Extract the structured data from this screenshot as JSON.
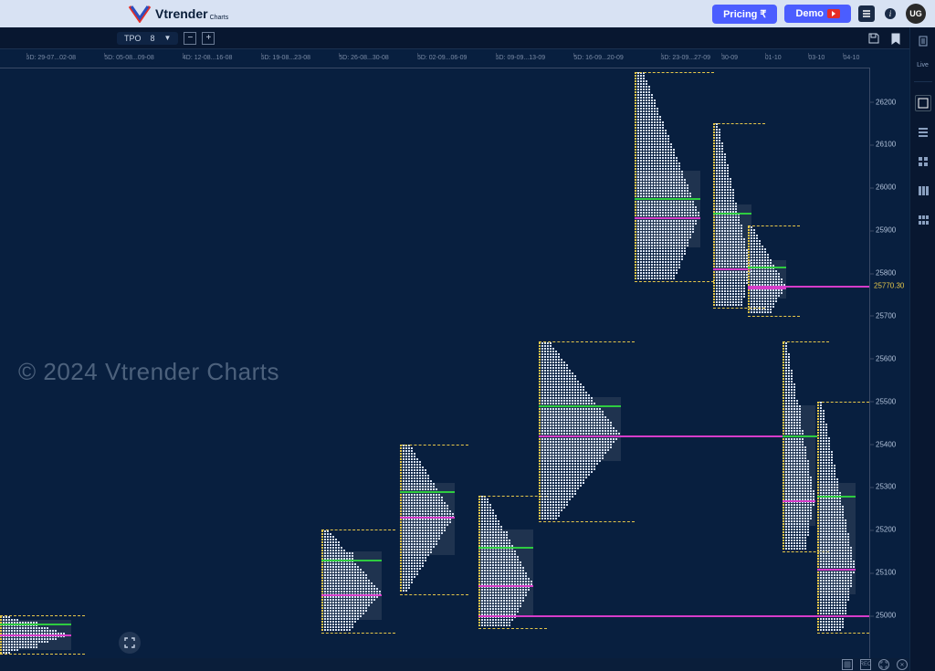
{
  "header": {
    "brand": "Vtrender",
    "brand_sub": "Charts",
    "pricing_label": "Pricing ₹",
    "demo_label": "Demo",
    "avatar_initials": "UG"
  },
  "toolbar": {
    "mode": "TPO",
    "value": "8"
  },
  "rail": {
    "live_label": "Live"
  },
  "watermark_text": "© 2024 Vtrender Charts",
  "chart_data": {
    "type": "market-profile",
    "instrument": "Index (TPO Market Profile)",
    "ylabel": "Price",
    "ylim": [
      24900,
      26280
    ],
    "current_price": 25770.3,
    "y_ticks": [
      26200,
      26100,
      26000,
      25900,
      25800,
      25700,
      25600,
      25500,
      25400,
      25300,
      25200,
      25100,
      25000
    ],
    "date_ticks": [
      {
        "label": "5D: 29-07...02-08",
        "x_pct": 3
      },
      {
        "label": "5D: 05-08...09-08",
        "x_pct": 12
      },
      {
        "label": "4D: 12-08...16-08",
        "x_pct": 21
      },
      {
        "label": "5D: 19-08...23-08",
        "x_pct": 30
      },
      {
        "label": "5D: 26-08...30-08",
        "x_pct": 39
      },
      {
        "label": "5D: 02-09...06-09",
        "x_pct": 48
      },
      {
        "label": "5D: 09-09...13-09",
        "x_pct": 57
      },
      {
        "label": "5D: 16-09...20-09",
        "x_pct": 66
      },
      {
        "label": "5D: 23-09...27-09",
        "x_pct": 76
      },
      {
        "label": "30-09",
        "x_pct": 83
      },
      {
        "label": "01-10",
        "x_pct": 88
      },
      {
        "label": "03-10",
        "x_pct": 93
      },
      {
        "label": "04-10",
        "x_pct": 97
      }
    ],
    "profiles": [
      {
        "id": "p1",
        "x_pct": 0,
        "low": 24910,
        "high": 25000,
        "va_low": 24920,
        "va_high": 24990,
        "poc": 24955,
        "vah_line": 24980,
        "width_max": 26
      },
      {
        "id": "p2",
        "x_pct": 37,
        "low": 24960,
        "high": 25200,
        "va_low": 24990,
        "va_high": 25150,
        "poc": 25050,
        "vah_line": 25130,
        "width_max": 22
      },
      {
        "id": "p3",
        "x_pct": 46,
        "low": 25050,
        "high": 25400,
        "va_low": 25140,
        "va_high": 25310,
        "poc": 25230,
        "vah_line": 25290,
        "width_max": 20
      },
      {
        "id": "p4",
        "x_pct": 55,
        "low": 24970,
        "high": 25280,
        "va_low": 25000,
        "va_high": 25200,
        "poc": 25070,
        "vah_line": 25160,
        "width_max": 20
      },
      {
        "id": "p5",
        "x_pct": 62,
        "low": 25220,
        "high": 25640,
        "va_low": 25360,
        "va_high": 25510,
        "poc": 25420,
        "vah_line": 25490,
        "width_max": 30
      },
      {
        "id": "p6",
        "x_pct": 73,
        "low": 25780,
        "high": 26270,
        "va_low": 25860,
        "va_high": 26040,
        "poc": 25930,
        "vah_line": 25975,
        "width_max": 24
      },
      {
        "id": "p7",
        "x_pct": 82,
        "low": 25720,
        "high": 26150,
        "va_low": 25790,
        "va_high": 25960,
        "poc": 25810,
        "vah_line": 25940,
        "width_max": 14
      },
      {
        "id": "p8",
        "x_pct": 86,
        "low": 25700,
        "high": 25910,
        "va_low": 25740,
        "va_high": 25830,
        "poc": 25765,
        "vah_line": 25815,
        "width_max": 14
      },
      {
        "id": "p9",
        "x_pct": 90,
        "low": 25150,
        "high": 25640,
        "va_low": 25210,
        "va_high": 25490,
        "poc": 25270,
        "vah_line": 25420,
        "width_max": 12
      },
      {
        "id": "p10",
        "x_pct": 94,
        "low": 24960,
        "high": 25500,
        "va_low": 25050,
        "va_high": 25310,
        "poc": 25110,
        "vah_line": 25280,
        "width_max": 14
      }
    ],
    "extended_lines": [
      {
        "from_profile": "p4",
        "price": 25000,
        "color": "magenta",
        "to_x_pct": 100
      },
      {
        "from_profile": "p5",
        "price": 25420,
        "color": "magenta",
        "to_x_pct": 90
      },
      {
        "from_profile": "p8",
        "price": 25770,
        "color": "magenta",
        "to_x_pct": 100
      },
      {
        "from_profile": "p9",
        "price": 25420,
        "color": "green",
        "to_x_pct": 94
      }
    ]
  }
}
